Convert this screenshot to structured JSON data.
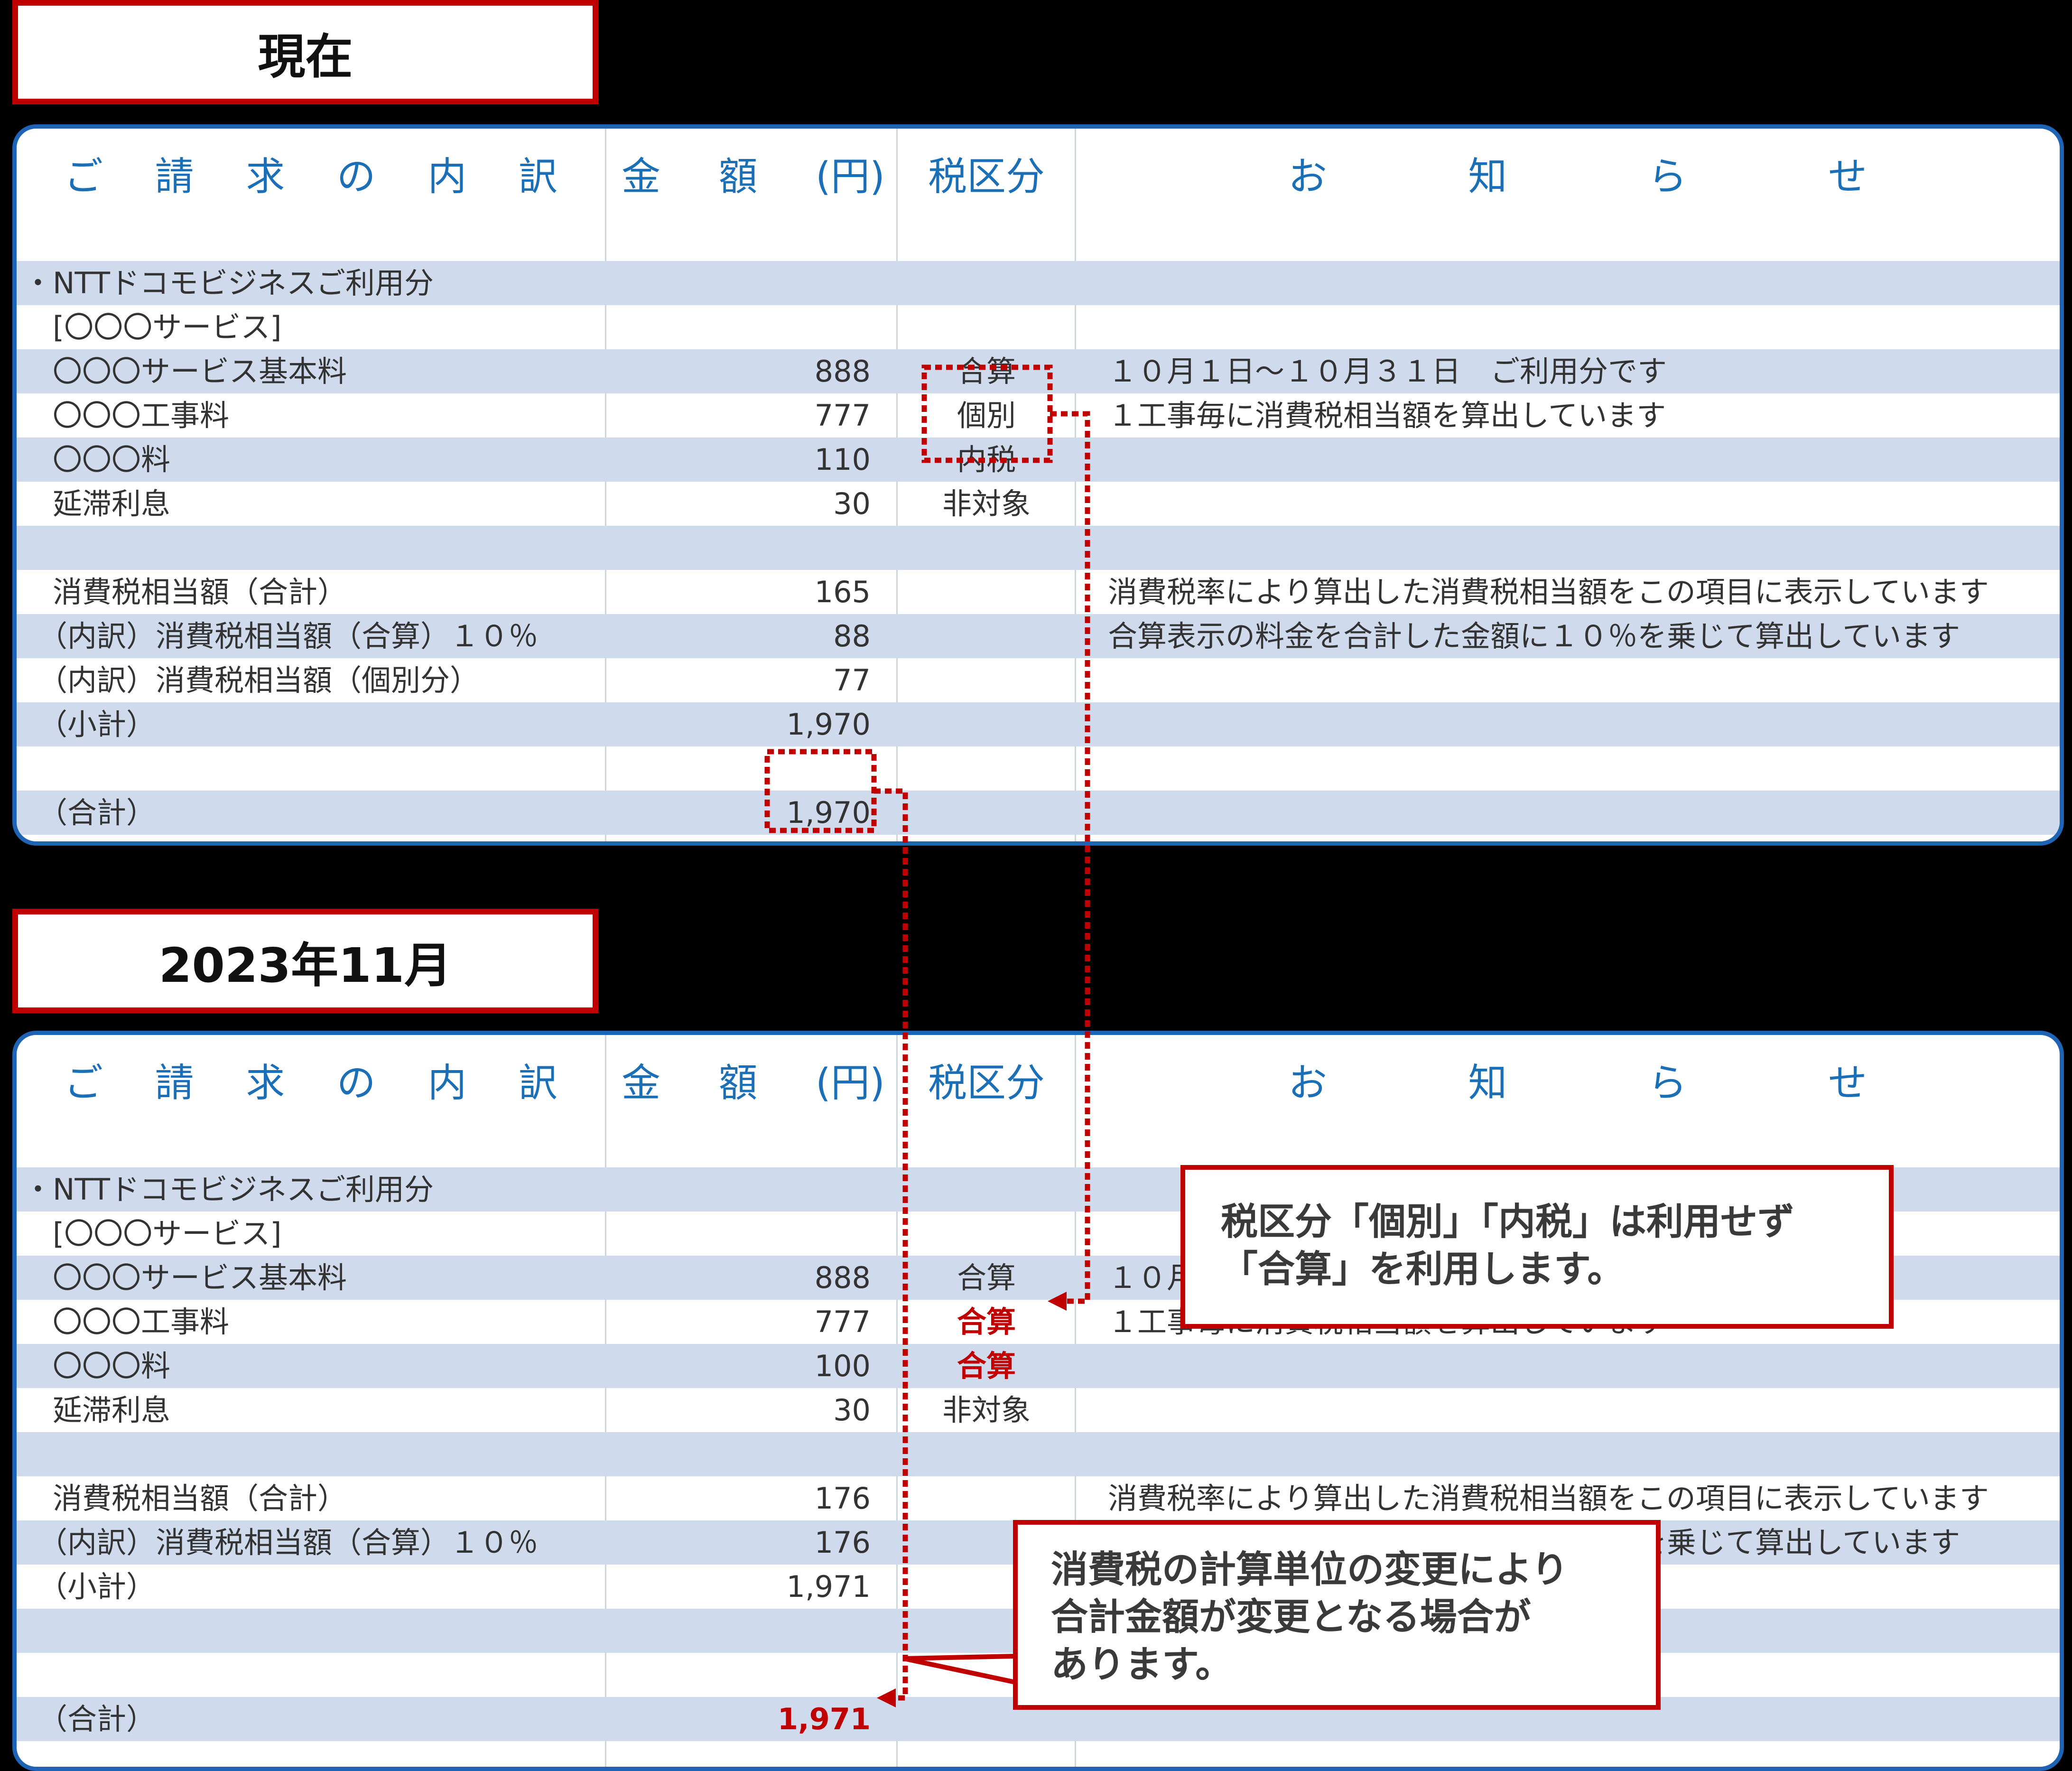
{
  "labels": {
    "current": "現在",
    "future": "2023年11月"
  },
  "header": {
    "item_chars": [
      "ご",
      "請",
      "求",
      "の",
      "内",
      "訳"
    ],
    "amount_chars": [
      "金",
      "額",
      "(円)"
    ],
    "tax": "税区分",
    "notice_chars": [
      "お",
      "知",
      "ら",
      "せ"
    ]
  },
  "current": {
    "rows": [
      {
        "item": "",
        "amount": "",
        "tax": "",
        "notice": "",
        "alt": false
      },
      {
        "item": "・NTTドコモビジネスご利用分",
        "amount": "",
        "tax": "",
        "notice": "",
        "alt": true
      },
      {
        "item": "　[〇〇〇サービス]",
        "amount": "",
        "tax": "",
        "notice": "",
        "alt": false
      },
      {
        "item": "　〇〇〇サービス基本料",
        "amount": "888",
        "tax": "合算",
        "notice": "１０月１日～１０月３１日　ご利用分です",
        "alt": true
      },
      {
        "item": "　〇〇〇工事料",
        "amount": "777",
        "tax": "個別",
        "notice": "１工事毎に消費税相当額を算出しています",
        "alt": false
      },
      {
        "item": "　〇〇〇料",
        "amount": "110",
        "tax": "内税",
        "notice": "",
        "alt": true
      },
      {
        "item": "　延滞利息",
        "amount": "30",
        "tax": "非対象",
        "notice": "",
        "alt": false
      },
      {
        "item": "",
        "amount": "",
        "tax": "",
        "notice": "",
        "alt": true
      },
      {
        "item": "　消費税相当額（合計）",
        "amount": "165",
        "tax": "",
        "notice": "消費税率により算出した消費税相当額をこの項目に表示しています",
        "alt": false
      },
      {
        "item": "　（内訳）消費税相当額（合算）１０％",
        "amount": "88",
        "tax": "",
        "notice": "合算表示の料金を合計した金額に１０％を乗じて算出しています",
        "alt": true
      },
      {
        "item": "　（内訳）消費税相当額（個別分）",
        "amount": "77",
        "tax": "",
        "notice": "",
        "alt": false
      },
      {
        "item": "　（小計）",
        "amount": "1,970",
        "tax": "",
        "notice": "",
        "alt": true
      },
      {
        "item": "",
        "amount": "",
        "tax": "",
        "notice": "",
        "alt": false
      },
      {
        "item": "　（合計）",
        "amount": "1,970",
        "tax": "",
        "notice": "",
        "alt": true
      },
      {
        "item": "",
        "amount": "",
        "tax": "",
        "notice": "",
        "alt": false
      }
    ]
  },
  "future": {
    "rows": [
      {
        "item": "",
        "amount": "",
        "tax": "",
        "notice": "",
        "alt": false
      },
      {
        "item": "・NTTドコモビジネスご利用分",
        "amount": "",
        "tax": "",
        "notice": "",
        "alt": true
      },
      {
        "item": "　[〇〇〇サービス]",
        "amount": "",
        "tax": "",
        "notice": "",
        "alt": false
      },
      {
        "item": "　〇〇〇サービス基本料",
        "amount": "888",
        "tax": "合算",
        "notice": "１０月１日～１０月３１日　ご利用分です",
        "alt": true
      },
      {
        "item": "　〇〇〇工事料",
        "amount": "777",
        "tax": "合算",
        "tax_red": true,
        "notice": "１工事毎に消費税相当額を算出しています",
        "alt": false
      },
      {
        "item": "　〇〇〇料",
        "amount": "100",
        "tax": "合算",
        "tax_red": true,
        "notice": "",
        "alt": true
      },
      {
        "item": "　延滞利息",
        "amount": "30",
        "tax": "非対象",
        "notice": "",
        "alt": false
      },
      {
        "item": "",
        "amount": "",
        "tax": "",
        "notice": "",
        "alt": true
      },
      {
        "item": "　消費税相当額（合計）",
        "amount": "176",
        "tax": "",
        "notice": "消費税率により算出した消費税相当額をこの項目に表示しています",
        "alt": false
      },
      {
        "item": "　（内訳）消費税相当額（合算）１０％",
        "amount": "176",
        "tax": "",
        "notice": "合算表示の料金を合計した金額に１０％を乗じて算出しています",
        "alt": true
      },
      {
        "item": "　（小計）",
        "amount": "1,971",
        "tax": "",
        "notice": "",
        "alt": false
      },
      {
        "item": "",
        "amount": "",
        "tax": "",
        "notice": "",
        "alt": true
      },
      {
        "item": "",
        "amount": "",
        "tax": "",
        "notice": "",
        "alt": false
      },
      {
        "item": "　（合計）",
        "amount": "1,971",
        "amount_red": true,
        "tax": "",
        "notice": "",
        "alt": true
      }
    ]
  },
  "callouts": {
    "tax_change": [
      "税区分「個別」「内税」は利用せず",
      "「合算」を利用します。"
    ],
    "total_change": [
      "消費税の計算単位の変更により",
      "合計金額が変更となる場合が",
      "あります。"
    ]
  },
  "colors": {
    "accent_red": "#c00000",
    "header_blue": "#1a6fb7",
    "border_blue": "#1f63b5",
    "stripe": "#cfdaec"
  }
}
